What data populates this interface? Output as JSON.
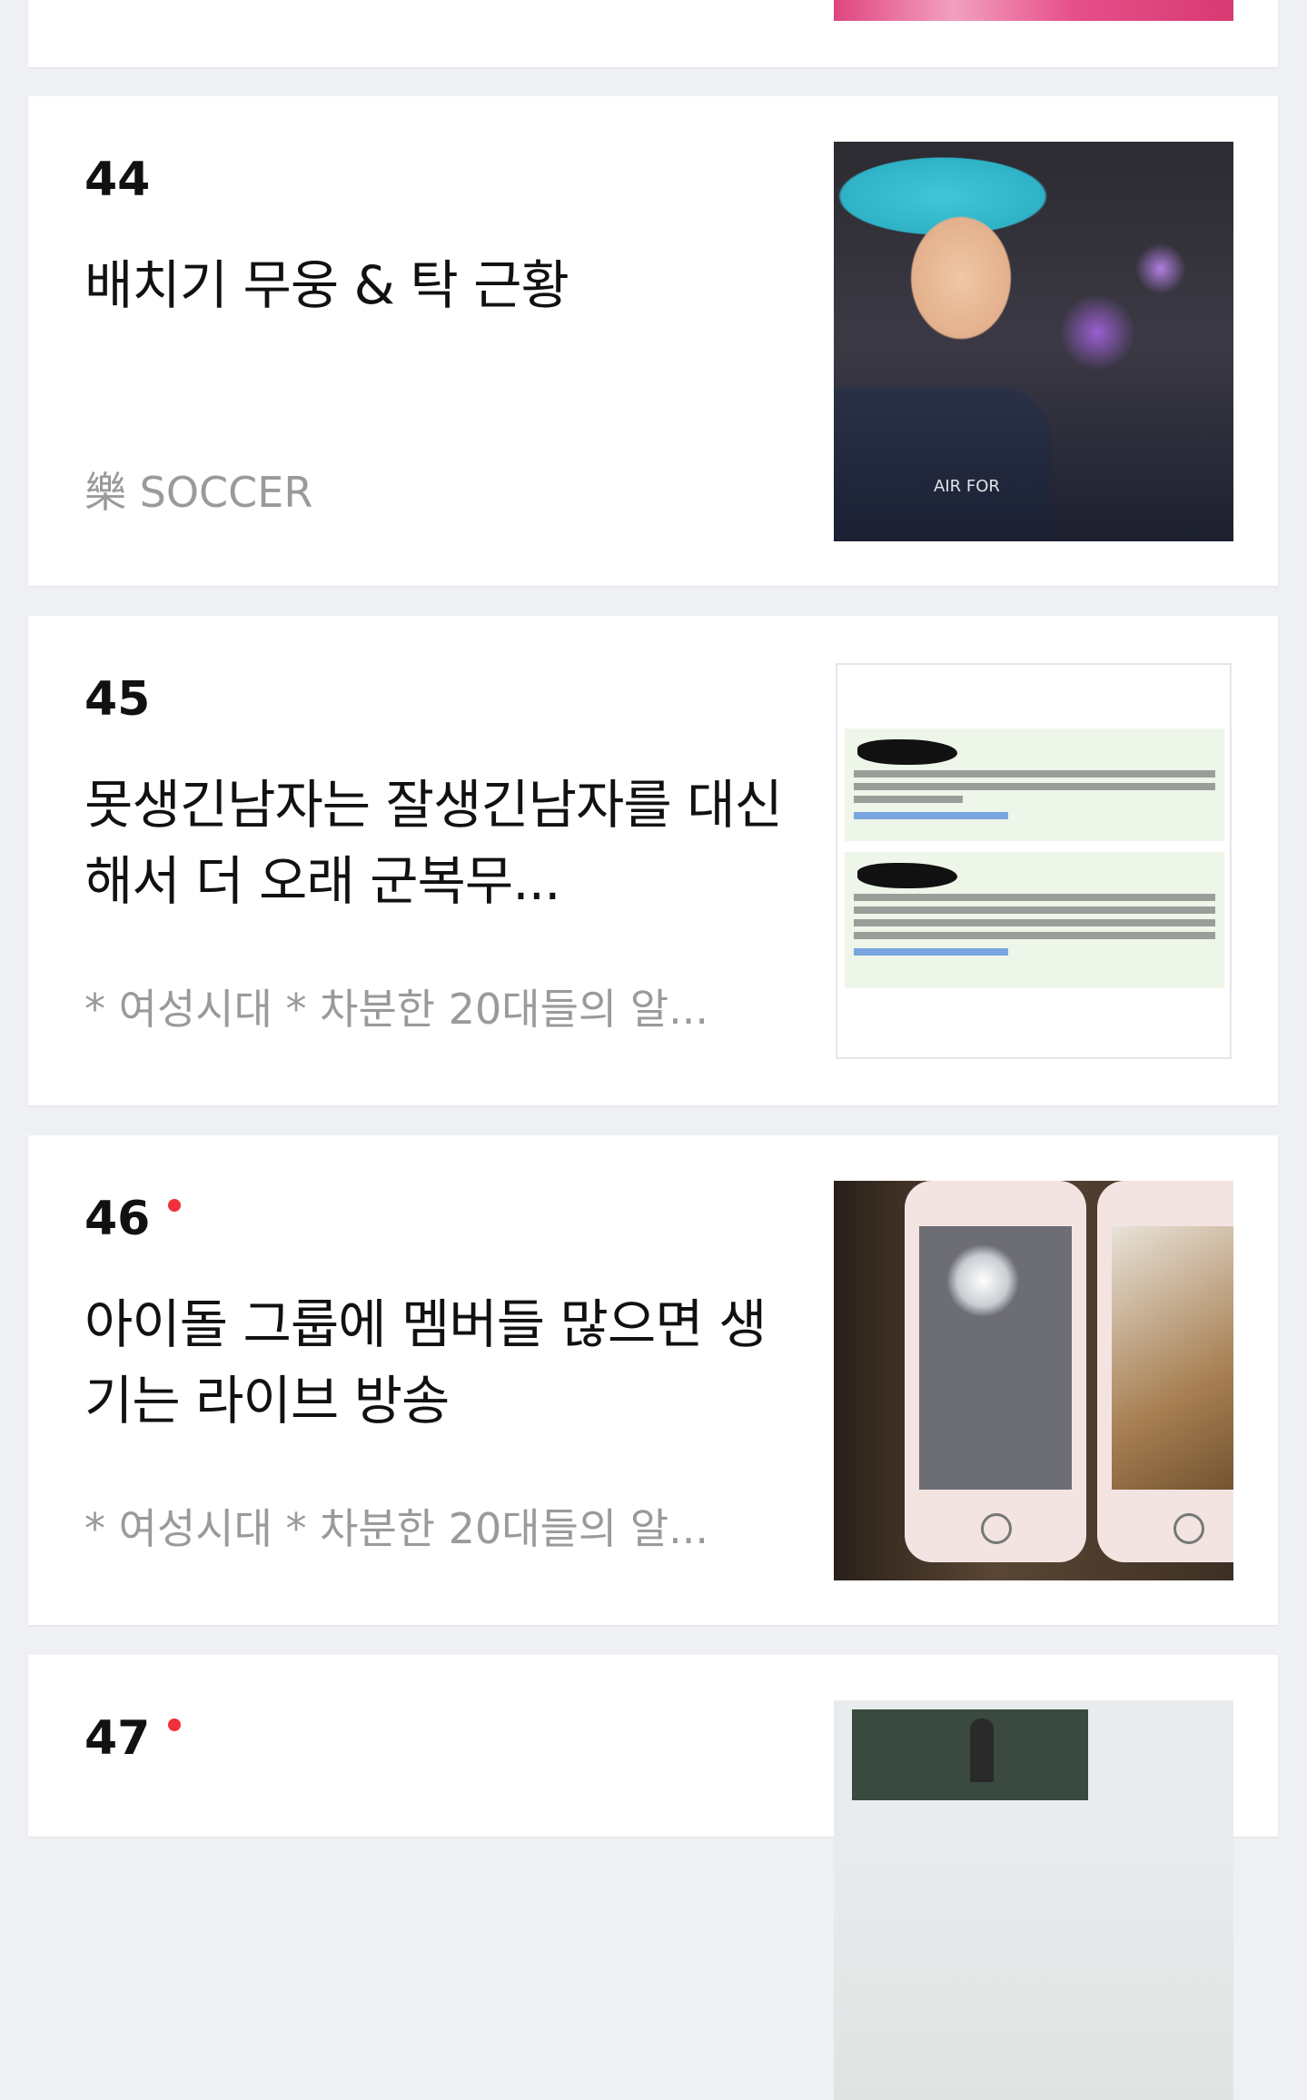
{
  "items": [
    {
      "thumbnail": "pink-photo-thumbnail"
    },
    {
      "rank": "44",
      "is_new": false,
      "title": "배치기 무웅 & 탁 근황",
      "source": "樂 SOCCER",
      "thumbnail": "selfie-photo-thumbnail",
      "thumb_text": "AIR FOR"
    },
    {
      "rank": "45",
      "is_new": false,
      "title": "못생긴남자는 잘생긴남자를 대신해서 더 오래 군복무...",
      "source": "* 여성시대 *  차분한 20대들의 알...",
      "thumbnail": "comment-screenshot-thumbnail"
    },
    {
      "rank": "46",
      "is_new": true,
      "title": "아이돌 그룹에 멤버들 많으면 생기는 라이브 방송",
      "source": "* 여성시대 *  차분한 20대들의 알...",
      "thumbnail": "phones-photo-thumbnail"
    },
    {
      "rank": "47",
      "is_new": true,
      "thumbnail": "lecture-photo-thumbnail"
    }
  ],
  "colors": {
    "background": "#eff0f3",
    "card": "#ffffff",
    "title_text": "#111111",
    "source_text": "#9a9a9a",
    "new_dot": "#f0303a"
  }
}
